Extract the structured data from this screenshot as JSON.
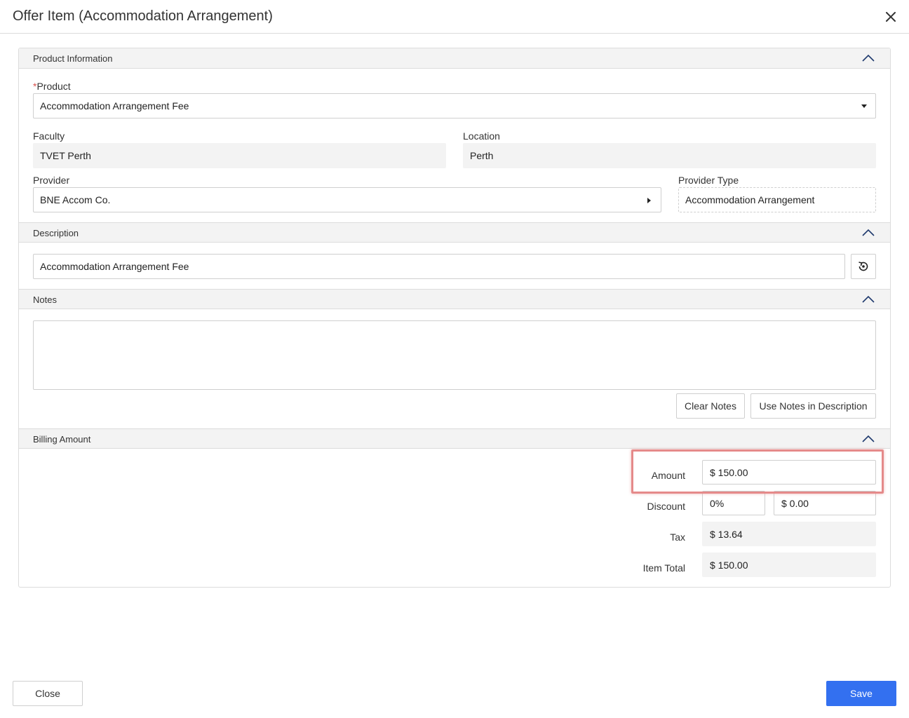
{
  "dialog": {
    "title": "Offer Item (Accommodation Arrangement)",
    "close_icon": "close-icon"
  },
  "sections": {
    "product_information": "Product Information",
    "description": "Description",
    "notes": "Notes",
    "billing_amount": "Billing Amount"
  },
  "product": {
    "required_mark": "*",
    "label": "Product",
    "value": "Accommodation Arrangement Fee"
  },
  "faculty": {
    "label": "Faculty",
    "value": "TVET Perth"
  },
  "location": {
    "label": "Location",
    "value": "Perth"
  },
  "provider": {
    "label": "Provider",
    "value": "BNE Accom Co."
  },
  "provider_type": {
    "label": "Provider Type",
    "value": "Accommodation Arrangement"
  },
  "description": {
    "value": "Accommodation Arrangement Fee"
  },
  "notes": {
    "value": "",
    "clear_label": "Clear Notes",
    "use_label": "Use Notes in Description"
  },
  "billing": {
    "amount_label": "Amount",
    "amount_value": "$ 150.00",
    "discount_label": "Discount",
    "discount_percent": "0%",
    "discount_amount": "$ 0.00",
    "tax_label": "Tax",
    "tax_value": "$ 13.64",
    "total_label": "Item Total",
    "total_value": "$ 150.00"
  },
  "footer": {
    "close_label": "Close",
    "save_label": "Save"
  },
  "colors": {
    "primary": "#3370f0",
    "highlight": "#e58a8a",
    "required": "#d9534f"
  }
}
